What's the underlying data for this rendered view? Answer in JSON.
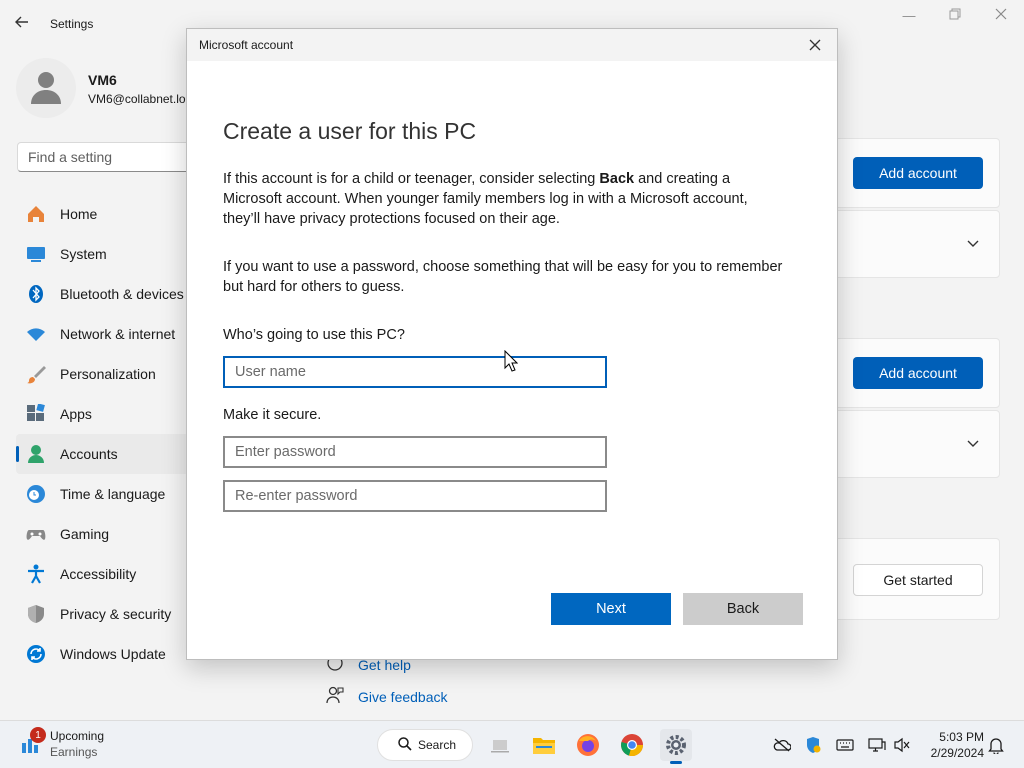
{
  "settings": {
    "title": "Settings",
    "profile": {
      "name": "VM6",
      "email": "VM6@collabnet.lo"
    },
    "search_placeholder": "Find a setting",
    "nav": [
      {
        "label": "Home",
        "icon": "home-icon"
      },
      {
        "label": "System",
        "icon": "monitor-icon"
      },
      {
        "label": "Bluetooth & devices",
        "icon": "bluetooth-icon"
      },
      {
        "label": "Network & internet",
        "icon": "wifi-icon"
      },
      {
        "label": "Personalization",
        "icon": "brush-icon"
      },
      {
        "label": "Apps",
        "icon": "apps-icon"
      },
      {
        "label": "Accounts",
        "icon": "accounts-icon",
        "active": true
      },
      {
        "label": "Time & language",
        "icon": "globe-clock-icon"
      },
      {
        "label": "Gaming",
        "icon": "gamepad-icon"
      },
      {
        "label": "Accessibility",
        "icon": "accessibility-icon"
      },
      {
        "label": "Privacy & security",
        "icon": "shield-icon"
      },
      {
        "label": "Windows Update",
        "icon": "update-icon"
      }
    ],
    "right": {
      "add_account_1": "Add account",
      "add_account_2": "Add account",
      "get_started": "Get started"
    },
    "links": {
      "get_help": "Get help",
      "give_feedback": "Give feedback"
    }
  },
  "dialog": {
    "title": "Microsoft account",
    "heading": "Create a user for this PC",
    "p1_before": "If this account is for a child or teenager, consider selecting ",
    "p1_bold": "Back",
    "p1_after": " and creating a Microsoft account. When younger family members log in with a Microsoft account, they’ll have privacy protections focused on their age.",
    "p2": "If you want to use a password, choose something that will be easy for you to remember but hard for others to guess.",
    "who_label": "Who’s going to use this PC?",
    "username_placeholder": "User name",
    "secure_label": "Make it secure.",
    "password_placeholder": "Enter password",
    "reenter_placeholder": "Re-enter password",
    "next_label": "Next",
    "back_label": "Back"
  },
  "taskbar": {
    "widget_badge": "1",
    "widget_title": "Upcoming",
    "widget_sub": "Earnings",
    "search_label": "Search",
    "time": "5:03 PM",
    "date": "2/29/2024"
  },
  "colors": {
    "accent": "#005fb8",
    "next_button": "#0067c0",
    "back_button": "#cccccc"
  }
}
